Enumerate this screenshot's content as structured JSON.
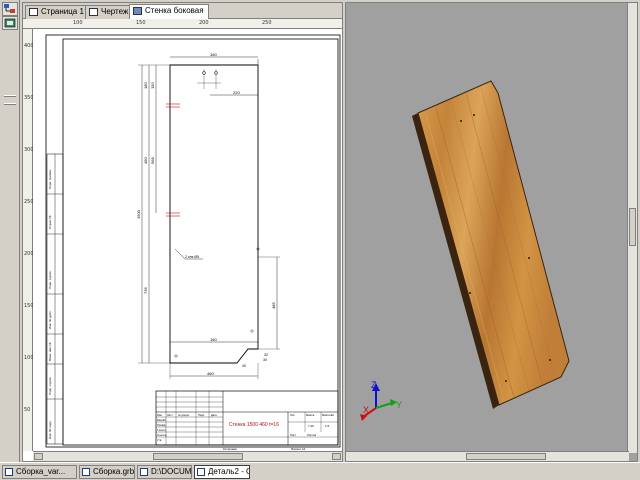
{
  "tabs": [
    {
      "label": "Страница 1",
      "icon": "page-icon",
      "active": false
    },
    {
      "label": "Чертеж",
      "icon": "drawing-icon",
      "active": false
    },
    {
      "label": "Стенка боковая",
      "icon": "part-icon",
      "active": true
    }
  ],
  "ruler": {
    "h_labels": [
      "100",
      "150",
      "200",
      "250"
    ],
    "v_labels": [
      "400",
      "350",
      "300",
      "250",
      "200",
      "150",
      "100",
      "50"
    ]
  },
  "drawing": {
    "dims": {
      "top_width": "160",
      "middle_width": "220",
      "bottom_width": "160",
      "total_width": "460",
      "left_180": "180",
      "left_150": "150",
      "left_1500": "1500",
      "left_736": "736",
      "left_490": "490",
      "left_568": "568",
      "right_485": "485",
      "bottom_40": "40",
      "bottom_a32": "32",
      "bottom_a30": "30",
      "hole_note": "2 отв.Ø5"
    },
    "title_text": "Стенка 1500 460 t=16",
    "title_block": {
      "lit": "Лит.",
      "mass": "Масса",
      "scale": "Масштаб",
      "mass_val": "7,26",
      "scale_val": "1:5",
      "sheet": "Лист",
      "sheets": "Листов",
      "copied": "Копировал",
      "format": "Формат A4",
      "izm": "Изм",
      "list": "Лист",
      "ndoc": "№ докум.",
      "podp": "Подп.",
      "data": "Дата",
      "razrab": "Разраб.",
      "prov": "Провер.",
      "tkontr": "Т.контр.",
      "nkontr": "Н.контр.",
      "utv": "Утв."
    },
    "side_stamp": [
      "Перв. примен.",
      "Справ. №",
      "Подп. и дата",
      "Инв. № дубл.",
      "Взам. инв. №",
      "Подп. и дата",
      "Инв. № подл."
    ]
  },
  "model": {
    "axis_x": "X",
    "axis_y": "Y",
    "axis_z": "Z",
    "colors": {
      "x": "#d01010",
      "y": "#10a010",
      "z": "#1010d0",
      "wood": "#c98a3a",
      "edge": "#3a2410"
    }
  },
  "doc_tabs": [
    {
      "label": "Сборка_var...",
      "active": false
    },
    {
      "label": "Сборка.grb",
      "active": false
    },
    {
      "label": "D:\\DOCUM...",
      "active": false
    },
    {
      "label": "Деталь2 - С...",
      "active": true
    }
  ]
}
